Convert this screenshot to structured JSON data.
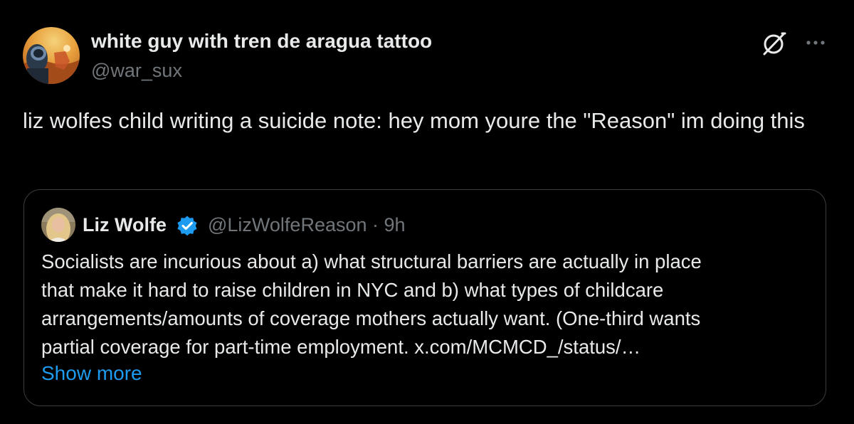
{
  "tweet": {
    "author": {
      "name": "white guy with tren de aragua tattoo",
      "handle": "@war_sux"
    },
    "text": "liz wolfes child writing a suicide note: hey mom youre the \"Reason\" im doing this",
    "actions": {
      "grok_icon": "grok-icon",
      "more_icon": "more-icon"
    }
  },
  "quote": {
    "author": {
      "name": "Liz Wolfe",
      "verified": true
    },
    "meta": "@LizWolfeReason · 9h",
    "lines": [
      "Socialists are incurious about a) what structural barriers are actually in place",
      "that make it hard to raise children in NYC and b) what types of childcare",
      "arrangements/amounts of coverage mothers actually want. (One-third wants",
      "partial coverage for part-time employment. x.com/MCMCD_/status/…"
    ],
    "show_more": "Show more"
  },
  "colors": {
    "background": "#000000",
    "primary_text": "#e7e9ea",
    "secondary_text": "#71767b",
    "link": "#1d9bf0",
    "verified_badge": "#1d9bf0",
    "card_border": "#3a3d41"
  }
}
